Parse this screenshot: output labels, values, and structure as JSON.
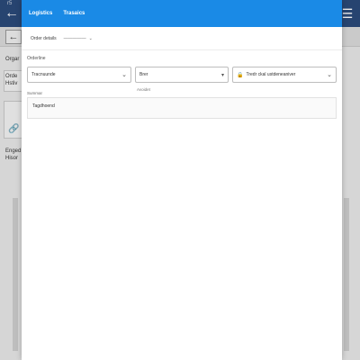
{
  "background": {
    "top_partial": "r5",
    "left_text_1": "Orgar",
    "left_text_2": "Orde",
    "left_text_3": "Hstiv",
    "left_text_4": "Enged",
    "left_text_5": "Hisor"
  },
  "panel": {
    "tabs": [
      {
        "label": "Logistics"
      },
      {
        "label": "Trasaics"
      }
    ],
    "subtoolbar": {
      "label": "Order details",
      "select_value": "—————"
    },
    "section_label": "Orderline",
    "fields": {
      "field1": {
        "value": "Tracnuunde"
      },
      "field2": {
        "value": "Brer",
        "note": "Avoidet"
      },
      "field3": {
        "value": "Tredr ckal ustdeneaniver"
      }
    },
    "summary": {
      "label": "Summar",
      "text": "Tagdhoend"
    }
  },
  "colors": {
    "header": "#1a8ae6",
    "bg_topbar": "#2b4a7a"
  }
}
